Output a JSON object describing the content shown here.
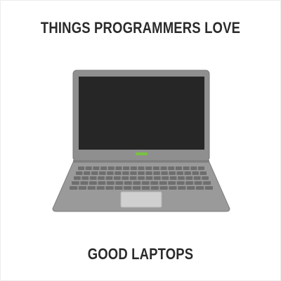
{
  "meme": {
    "top_text": "THINGS PROGRAMMERS LOVE",
    "bottom_text": "GOOD LAPTOPS"
  },
  "illustration": {
    "subject": "laptop-icon",
    "colors": {
      "body": "#8f8f8f",
      "body_edge": "#7a7a7a",
      "screen": "#262626",
      "keyboard_deck": "#9a9a9a",
      "key": "#6e6e6e",
      "touchpad": "#d0d0d0",
      "indicator": "#79c142"
    }
  }
}
